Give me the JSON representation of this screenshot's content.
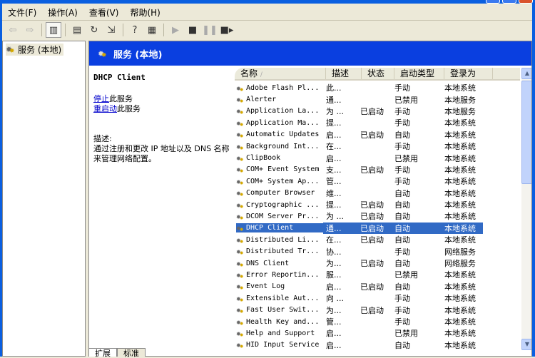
{
  "menubar": [
    "文件(F)",
    "操作(A)",
    "查看(V)",
    "帮助(H)"
  ],
  "tree": {
    "root": "服务 (本地)"
  },
  "header": {
    "title": "服务 (本地)"
  },
  "detail": {
    "service_name": "DHCP Client",
    "stop_link": "停止",
    "stop_suffix": "此服务",
    "restart_link": "重启动",
    "restart_suffix": "此服务",
    "desc_label": "描述:",
    "description": "通过注册和更改 IP 地址以及 DNS 名称来管理网络配置。"
  },
  "columns": [
    "名称",
    "描述",
    "状态",
    "启动类型",
    "登录为"
  ],
  "rows": [
    [
      "Adobe Flash Pl...",
      "此...",
      "",
      "手动",
      "本地系统"
    ],
    [
      "Alerter",
      "通...",
      "",
      "已禁用",
      "本地服务"
    ],
    [
      "Application La...",
      "为 ...",
      "已启动",
      "手动",
      "本地服务"
    ],
    [
      "Application Ma...",
      "提...",
      "",
      "手动",
      "本地系统"
    ],
    [
      "Automatic Updates",
      "启...",
      "已启动",
      "自动",
      "本地系统"
    ],
    [
      "Background Int...",
      "在...",
      "",
      "手动",
      "本地系统"
    ],
    [
      "ClipBook",
      "启...",
      "",
      "已禁用",
      "本地系统"
    ],
    [
      "COM+ Event System",
      "支...",
      "已启动",
      "手动",
      "本地系统"
    ],
    [
      "COM+ System Ap...",
      "管...",
      "",
      "手动",
      "本地系统"
    ],
    [
      "Computer Browser",
      "维...",
      "",
      "自动",
      "本地系统"
    ],
    [
      "Cryptographic ...",
      "提...",
      "已启动",
      "自动",
      "本地系统"
    ],
    [
      "DCOM Server Pr...",
      "为 ...",
      "已启动",
      "自动",
      "本地系统"
    ],
    [
      "DHCP Client",
      "通...",
      "已启动",
      "自动",
      "本地系统"
    ],
    [
      "Distributed Li...",
      "在...",
      "已启动",
      "自动",
      "本地系统"
    ],
    [
      "Distributed Tr...",
      "协...",
      "",
      "手动",
      "网络服务"
    ],
    [
      "DNS Client",
      "为...",
      "已启动",
      "自动",
      "网络服务"
    ],
    [
      "Error Reportin...",
      "服...",
      "",
      "已禁用",
      "本地系统"
    ],
    [
      "Event Log",
      "启...",
      "已启动",
      "自动",
      "本地系统"
    ],
    [
      "Extensible Aut...",
      "向 ...",
      "",
      "手动",
      "本地系统"
    ],
    [
      "Fast User Swit...",
      "为...",
      "已启动",
      "手动",
      "本地系统"
    ],
    [
      "Health Key and...",
      "管...",
      "",
      "手动",
      "本地系统"
    ],
    [
      "Help and Support",
      "启...",
      "",
      "已禁用",
      "本地系统"
    ],
    [
      "HID Input Service",
      "启...",
      "",
      "自动",
      "本地系统"
    ]
  ],
  "selected_row": 12,
  "tabs": [
    "扩展",
    "标准"
  ],
  "colors": {
    "selection": "#316ac5",
    "header_blue": "#0a3fe0",
    "link": "#0000cc"
  }
}
